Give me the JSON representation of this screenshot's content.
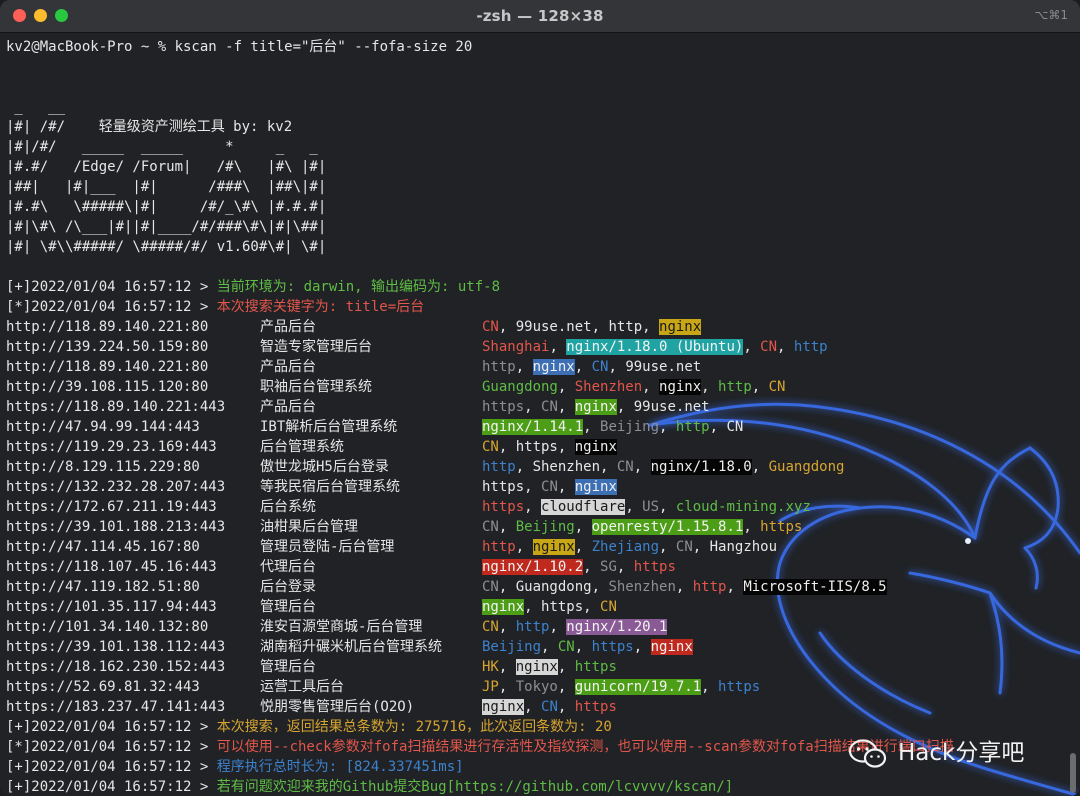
{
  "window": {
    "title": "-zsh — 128×38",
    "shortcut": "⌥⌘1"
  },
  "terminal": {
    "command_line": "kv2@MacBook-Pro ~ % kscan -f title=\"后台\" --fofa-size 20",
    "banner": [
      " _   __",
      "|#| /#/    轻量级资产测绘工具 by: kv2",
      "|#|/#/   _____  _____     *     _   _",
      "|#.#/   /Edge/ /Forum|   /#\\   |#\\ |#|",
      "|##|   |#|___  |#|      /###\\  |##\\|#|",
      "|#.#\\   \\#####\\|#|     /#/_\\#\\ |#.#.#|",
      "|#|\\#\\ /\\___|#||#|____/#/###\\#\\|#|\\##|",
      "|#| \\#\\\\#####/ \\#####/#/ v1.60#\\#| \\#|"
    ],
    "log_top": [
      {
        "prefix": "[+]2022/01/04 16:57:12 > ",
        "message": "当前环境为: darwin, 输出编码为: utf-8",
        "color": "#5fbd45"
      },
      {
        "prefix": "[*]2022/01/04 16:57:12 > ",
        "message": "本次搜索关键字为: title=后台",
        "color": "#e2564b"
      }
    ],
    "results": [
      {
        "url": "http://118.89.140.221:80",
        "title": "产品后台",
        "tags": [
          {
            "text": "CN",
            "style": "r"
          },
          {
            "text": ", ",
            "style": "w"
          },
          {
            "text": "99use.net",
            "style": "w"
          },
          {
            "text": ", ",
            "style": "w"
          },
          {
            "text": "http",
            "style": "w"
          },
          {
            "text": ", ",
            "style": "w"
          },
          {
            "text": "nginx",
            "style": "hl-yellow"
          }
        ]
      },
      {
        "url": "http://139.224.50.159:80",
        "title": "智造专家管理后台",
        "tags": [
          {
            "text": "Shanghai",
            "style": "r"
          },
          {
            "text": ", ",
            "style": "w"
          },
          {
            "text": "nginx/1.18.0 (Ubuntu)",
            "style": "hl-cyan"
          },
          {
            "text": ", ",
            "style": "w"
          },
          {
            "text": "CN",
            "style": "r"
          },
          {
            "text": ", ",
            "style": "w"
          },
          {
            "text": "http",
            "style": "b"
          }
        ]
      },
      {
        "url": "http://118.89.140.221:80",
        "title": "产品后台",
        "tags": [
          {
            "text": "http",
            "style": "dim"
          },
          {
            "text": ", ",
            "style": "w"
          },
          {
            "text": "nginx",
            "style": "hl-blue"
          },
          {
            "text": ", ",
            "style": "w"
          },
          {
            "text": "CN",
            "style": "b"
          },
          {
            "text": ", ",
            "style": "w"
          },
          {
            "text": "99use.net",
            "style": "w"
          }
        ]
      },
      {
        "url": "http://39.108.115.120:80",
        "title": "职袖后台管理系统",
        "tags": [
          {
            "text": "Guangdong",
            "style": "g"
          },
          {
            "text": ", ",
            "style": "w"
          },
          {
            "text": "Shenzhen",
            "style": "r"
          },
          {
            "text": ", ",
            "style": "w"
          },
          {
            "text": "nginx",
            "style": "hl-black"
          },
          {
            "text": ", ",
            "style": "w"
          },
          {
            "text": "http",
            "style": "g"
          },
          {
            "text": ", ",
            "style": "w"
          },
          {
            "text": "CN",
            "style": "y"
          }
        ]
      },
      {
        "url": "https://118.89.140.221:443",
        "title": "产品后台",
        "tags": [
          {
            "text": "https",
            "style": "dim"
          },
          {
            "text": ", ",
            "style": "w"
          },
          {
            "text": "CN",
            "style": "dim"
          },
          {
            "text": ", ",
            "style": "w"
          },
          {
            "text": "nginx",
            "style": "hl-green"
          },
          {
            "text": ", ",
            "style": "w"
          },
          {
            "text": "99use.net",
            "style": "w"
          }
        ]
      },
      {
        "url": "http://47.94.99.144:443",
        "title": "IBT解析后台管理系统",
        "tags": [
          {
            "text": "nginx/1.14.1",
            "style": "hl-green"
          },
          {
            "text": ", ",
            "style": "w"
          },
          {
            "text": "Beijing",
            "style": "dim"
          },
          {
            "text": ", ",
            "style": "w"
          },
          {
            "text": "http",
            "style": "g"
          },
          {
            "text": ", ",
            "style": "w"
          },
          {
            "text": "CN",
            "style": "w"
          }
        ]
      },
      {
        "url": "https://119.29.23.169:443",
        "title": "后台管理系统",
        "tags": [
          {
            "text": "CN",
            "style": "y"
          },
          {
            "text": ", ",
            "style": "w"
          },
          {
            "text": "https",
            "style": "w"
          },
          {
            "text": ", ",
            "style": "w"
          },
          {
            "text": "nginx",
            "style": "hl-black"
          }
        ]
      },
      {
        "url": "http://8.129.115.229:80",
        "title": "傲世龙城H5后台登录",
        "tags": [
          {
            "text": "http",
            "style": "b"
          },
          {
            "text": ", ",
            "style": "w"
          },
          {
            "text": "Shenzhen",
            "style": "w"
          },
          {
            "text": ", ",
            "style": "w"
          },
          {
            "text": "CN",
            "style": "dim"
          },
          {
            "text": ", ",
            "style": "w"
          },
          {
            "text": "nginx/1.18.0",
            "style": "hl-black"
          },
          {
            "text": ", ",
            "style": "w"
          },
          {
            "text": "Guangdong",
            "style": "y"
          }
        ]
      },
      {
        "url": "https://132.232.28.207:443",
        "title": "等我民宿后台管理系统",
        "tags": [
          {
            "text": "https",
            "style": "w"
          },
          {
            "text": ", ",
            "style": "w"
          },
          {
            "text": "CN",
            "style": "dim"
          },
          {
            "text": ", ",
            "style": "w"
          },
          {
            "text": "nginx",
            "style": "hl-blue"
          }
        ]
      },
      {
        "url": "https://172.67.211.19:443",
        "title": "后台系统",
        "tags": [
          {
            "text": "https",
            "style": "r"
          },
          {
            "text": ", ",
            "style": "w"
          },
          {
            "text": "cloudflare",
            "style": "hl-white"
          },
          {
            "text": ", ",
            "style": "w"
          },
          {
            "text": "US",
            "style": "dim"
          },
          {
            "text": ", ",
            "style": "w"
          },
          {
            "text": "cloud-mining.xyz",
            "style": "g"
          }
        ]
      },
      {
        "url": "https://39.101.188.213:443",
        "title": "油柑果后台管理",
        "tags": [
          {
            "text": "CN",
            "style": "dim"
          },
          {
            "text": ", ",
            "style": "w"
          },
          {
            "text": "Beijing",
            "style": "g"
          },
          {
            "text": ", ",
            "style": "w"
          },
          {
            "text": "openresty/1.15.8.1",
            "style": "hl-green"
          },
          {
            "text": ", ",
            "style": "w"
          },
          {
            "text": "https",
            "style": "y"
          }
        ]
      },
      {
        "url": "http://47.114.45.167:80",
        "title": "管理员登陆-后台管理",
        "tags": [
          {
            "text": "http",
            "style": "r"
          },
          {
            "text": ", ",
            "style": "w"
          },
          {
            "text": "nginx",
            "style": "hl-yellow"
          },
          {
            "text": ", ",
            "style": "w"
          },
          {
            "text": "Zhejiang",
            "style": "b"
          },
          {
            "text": ", ",
            "style": "w"
          },
          {
            "text": "CN",
            "style": "dim"
          },
          {
            "text": ", ",
            "style": "w"
          },
          {
            "text": "Hangzhou",
            "style": "w"
          }
        ]
      },
      {
        "url": "https://118.107.45.16:443",
        "title": "代理后台",
        "tags": [
          {
            "text": "nginx/1.10.2",
            "style": "hl-red"
          },
          {
            "text": ", ",
            "style": "w"
          },
          {
            "text": "SG",
            "style": "dim"
          },
          {
            "text": ", ",
            "style": "w"
          },
          {
            "text": "https",
            "style": "r"
          }
        ]
      },
      {
        "url": "http://47.119.182.51:80",
        "title": "后台登录",
        "tags": [
          {
            "text": "CN",
            "style": "dim"
          },
          {
            "text": ", ",
            "style": "w"
          },
          {
            "text": "Guangdong",
            "style": "w"
          },
          {
            "text": ", ",
            "style": "w"
          },
          {
            "text": "Shenzhen",
            "style": "dim"
          },
          {
            "text": ", ",
            "style": "w"
          },
          {
            "text": "http",
            "style": "r"
          },
          {
            "text": ", ",
            "style": "w"
          },
          {
            "text": "Microsoft-IIS/8.5",
            "style": "hl-black"
          }
        ]
      },
      {
        "url": "https://101.35.117.94:443",
        "title": "管理后台",
        "tags": [
          {
            "text": "nginx",
            "style": "hl-green"
          },
          {
            "text": ", ",
            "style": "w"
          },
          {
            "text": "https",
            "style": "w"
          },
          {
            "text": ", ",
            "style": "w"
          },
          {
            "text": "CN",
            "style": "y"
          }
        ]
      },
      {
        "url": "http://101.34.140.132:80",
        "title": "淮安百源堂商城-后台管理",
        "tags": [
          {
            "text": "CN",
            "style": "y"
          },
          {
            "text": ", ",
            "style": "w"
          },
          {
            "text": "http",
            "style": "b"
          },
          {
            "text": ", ",
            "style": "w"
          },
          {
            "text": "nginx/1.20.1",
            "style": "hl-purple"
          }
        ]
      },
      {
        "url": "https://39.101.138.112:443",
        "title": "湖南稻升碾米机后台管理系统",
        "tags": [
          {
            "text": "Beijing",
            "style": "b"
          },
          {
            "text": ", ",
            "style": "w"
          },
          {
            "text": "CN",
            "style": "g"
          },
          {
            "text": ", ",
            "style": "w"
          },
          {
            "text": "https",
            "style": "b"
          },
          {
            "text": ", ",
            "style": "w"
          },
          {
            "text": "nginx",
            "style": "hl-red"
          }
        ]
      },
      {
        "url": "https://18.162.230.152:443",
        "title": "管理后台",
        "tags": [
          {
            "text": "HK",
            "style": "y"
          },
          {
            "text": ", ",
            "style": "w"
          },
          {
            "text": "nginx",
            "style": "hl-white"
          },
          {
            "text": ", ",
            "style": "w"
          },
          {
            "text": "https",
            "style": "g"
          }
        ]
      },
      {
        "url": "https://52.69.81.32:443",
        "title": "运营工具后台",
        "tags": [
          {
            "text": "JP",
            "style": "y"
          },
          {
            "text": ", ",
            "style": "w"
          },
          {
            "text": "Tokyo",
            "style": "dim"
          },
          {
            "text": ", ",
            "style": "w"
          },
          {
            "text": "gunicorn/19.7.1",
            "style": "hl-green"
          },
          {
            "text": ", ",
            "style": "w"
          },
          {
            "text": "https",
            "style": "b"
          }
        ]
      },
      {
        "url": "https://183.237.47.141:443",
        "title": "悦朋零售管理后台(O2O)",
        "tags": [
          {
            "text": "nginx",
            "style": "hl-white"
          },
          {
            "text": ", ",
            "style": "w"
          },
          {
            "text": "CN",
            "style": "b"
          },
          {
            "text": ", ",
            "style": "w"
          },
          {
            "text": "https",
            "style": "r"
          }
        ]
      }
    ],
    "log_bottom": [
      {
        "prefix": "[+]2022/01/04 16:57:12 > ",
        "message": "本次搜索，返回结果总条数为: 275716，此次返回条数为: 20",
        "color": "#d8a531"
      },
      {
        "prefix": "[*]2022/01/04 16:57:12 > ",
        "message": "可以使用--check参数对fofa扫描结果进行存活性及指纹探测，也可以使用--scan参数对fofa扫描结果进行端口扫描",
        "color": "#e2564b"
      },
      {
        "prefix": "[+]2022/01/04 16:57:12 > ",
        "message": "程序执行总时长为: [824.337451ms]",
        "color": "#3d82cd"
      },
      {
        "prefix": "[+]2022/01/04 16:57:12 > ",
        "message": "若有问题欢迎来我的Github提交Bug[https://github.com/lcvvvv/kscan/]",
        "color": "#5fbd45"
      }
    ],
    "prompt": "kv2@MacBook-Pro ~ % "
  },
  "watermark": {
    "text": "Hack分享吧",
    "icon": "wechat-icon"
  },
  "colors": {
    "background": "#202225",
    "dragon_glow": "#3a6ff2"
  }
}
